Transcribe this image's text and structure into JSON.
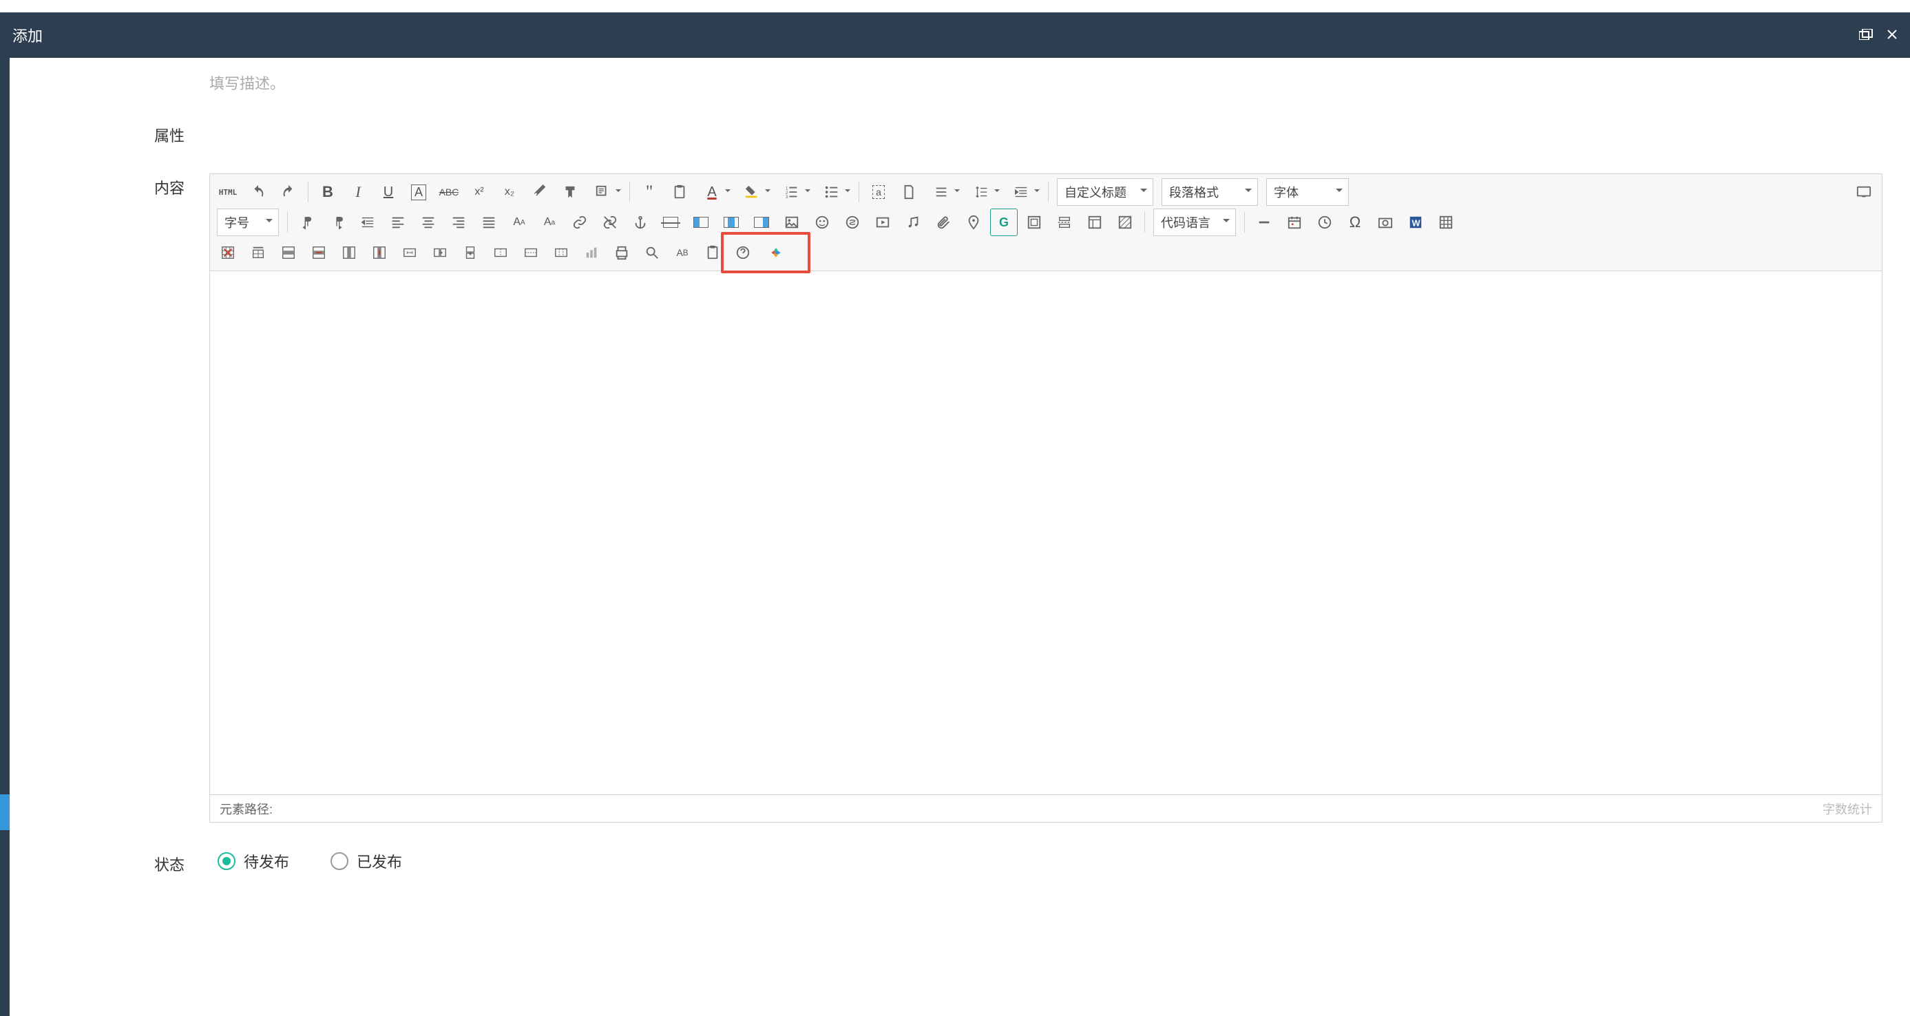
{
  "header": {
    "title": "添加"
  },
  "form": {
    "desc_placeholder": "填写描述。",
    "attr_label": "属性",
    "content_label": "内容",
    "status_label": "状态"
  },
  "editor": {
    "dropdowns": {
      "custom_title": "自定义标题",
      "paragraph": "段落格式",
      "font_family": "字体",
      "font_size": "字号",
      "code_lang": "代码语言"
    },
    "html_label": "HTML",
    "statusbar": {
      "path_label": "元素路径:",
      "wordcount_label": "字数统计"
    }
  },
  "status": {
    "pending": "待发布",
    "published": "已发布"
  }
}
